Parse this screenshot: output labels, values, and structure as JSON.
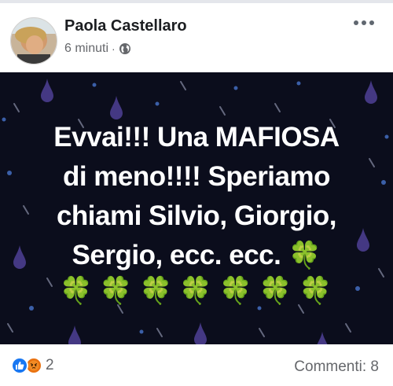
{
  "post": {
    "author": "Paola Castellaro",
    "time": "6 minuti",
    "separator": "·",
    "privacy_icon": "globe-icon",
    "more_icon": "more-options-icon"
  },
  "content": {
    "lines": [
      "Evvai!!! Una MAFIOSA",
      "di meno!!!! Speriamo",
      "chiami Silvio, Giorgio,",
      "Sergio, ecc. ecc."
    ],
    "inline_emoji": "🍀",
    "clover_row": [
      "🍀",
      "🍀",
      "🍀",
      "🍀",
      "🍀",
      "🍀",
      "🍀"
    ],
    "text_color": "#ffffff",
    "background_color": "#0b0d1c"
  },
  "footer": {
    "reaction_icons": [
      "like-icon",
      "angry-icon"
    ],
    "reaction_count": "2",
    "comments": "Commenti: 8"
  }
}
